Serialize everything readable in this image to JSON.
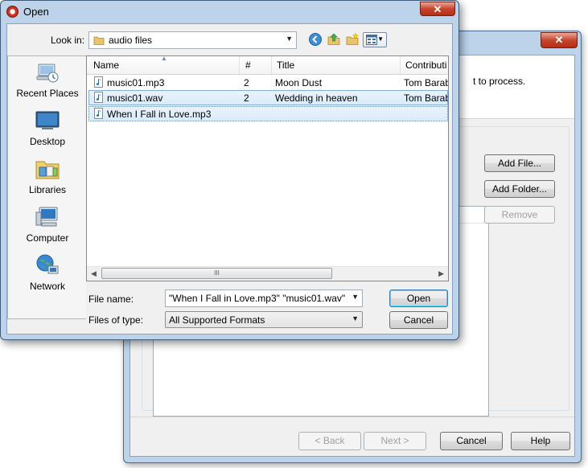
{
  "bg_window": {
    "close_glyph": "✕",
    "header_text": "t to process.",
    "buttons": {
      "add_file": "Add File...",
      "add_folder": "Add Folder...",
      "remove": "Remove",
      "back": "< Back",
      "next": "Next >",
      "cancel": "Cancel",
      "help": "Help"
    }
  },
  "open_dialog": {
    "title": "Open",
    "close_glyph": "✕",
    "look_in": {
      "label": "Look in:",
      "value": "audio files"
    },
    "places": [
      {
        "label": "Recent Places",
        "icon": "recent-places-icon"
      },
      {
        "label": "Desktop",
        "icon": "desktop-icon"
      },
      {
        "label": "Libraries",
        "icon": "libraries-icon"
      },
      {
        "label": "Computer",
        "icon": "computer-icon"
      },
      {
        "label": "Network",
        "icon": "network-icon"
      }
    ],
    "columns": {
      "name": "Name",
      "num": "#",
      "title": "Title",
      "contrib": "Contributi"
    },
    "files": [
      {
        "name": "music01.mp3",
        "num": "2",
        "title": "Moon Dust",
        "contrib": "Tom Barab"
      },
      {
        "name": "music01.wav",
        "num": "2",
        "title": "Wedding in heaven",
        "contrib": "Tom Barab"
      },
      {
        "name": "When I Fall in Love.mp3",
        "num": "",
        "title": "",
        "contrib": ""
      }
    ],
    "scroll_grip": "III",
    "file_name": {
      "label": "File name:",
      "value": "\"When I Fall in Love.mp3\" \"music01.wav\""
    },
    "file_type": {
      "label": "Files of type:",
      "value": "All Supported Formats"
    },
    "buttons": {
      "open": "Open",
      "cancel": "Cancel"
    }
  },
  "colors": {
    "frame": "#bcd3ea",
    "selection": "#d9ebfc",
    "close_red": "#c7452c"
  }
}
